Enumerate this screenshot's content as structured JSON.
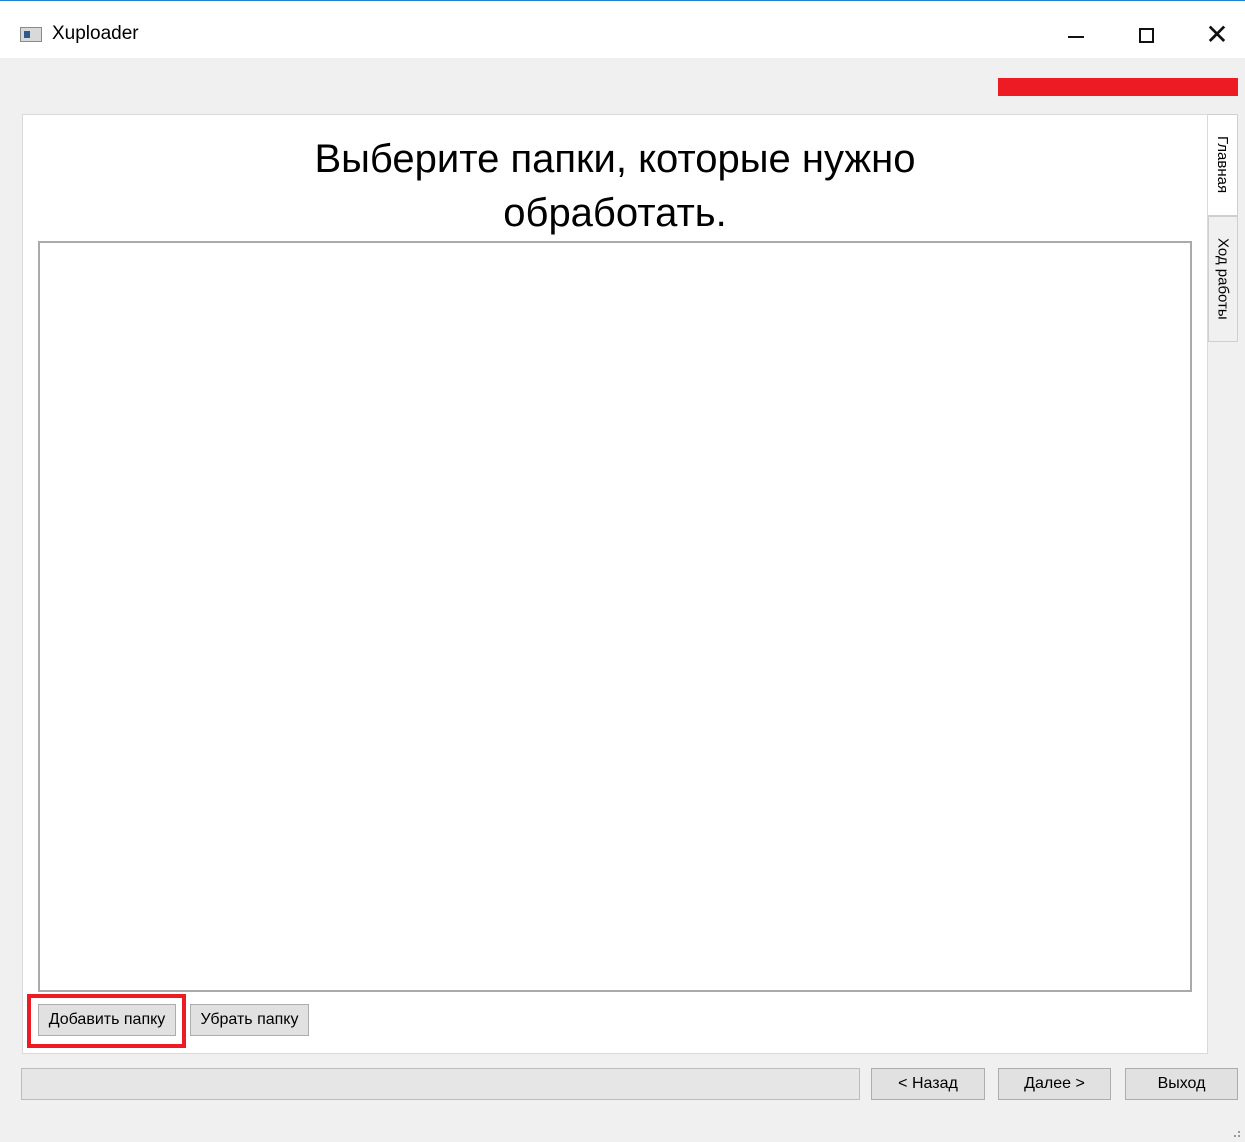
{
  "window": {
    "title": "Xuploader",
    "controls": {
      "minimize": "minimize-icon",
      "maximize": "maximize-icon",
      "close": "close-icon"
    }
  },
  "main": {
    "heading_line1": "Выберите папки, которые нужно",
    "heading_line2": "обработать.",
    "folders": []
  },
  "tabs": [
    {
      "label": "Главная",
      "active": true
    },
    {
      "label": "Ход работы",
      "active": false
    }
  ],
  "folder_buttons": {
    "add": "Добавить папку",
    "remove": "Убрать папку"
  },
  "footer": {
    "progress": 0,
    "back": "< Назад",
    "next": "Далее >",
    "exit": "Выход"
  },
  "colors": {
    "highlight": "#ed1c24",
    "title_border": "#1e82d2"
  }
}
